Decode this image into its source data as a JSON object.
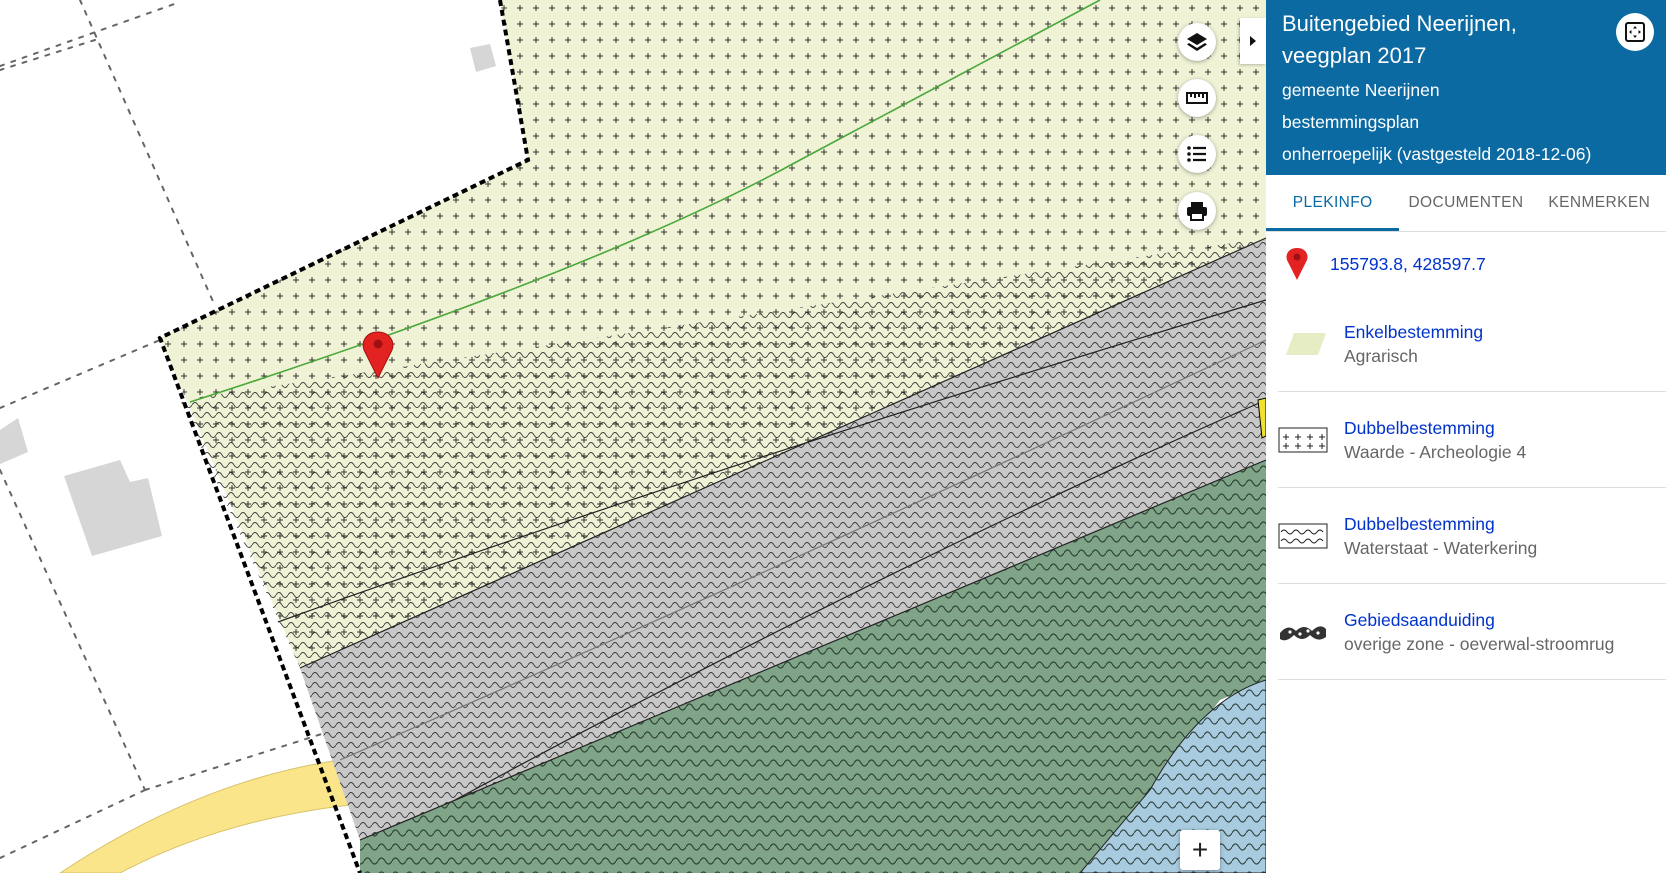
{
  "map": {
    "pin_icon": "map-marker-icon",
    "tools": [
      {
        "name": "layers-button",
        "icon": "layers-icon"
      },
      {
        "name": "measure-button",
        "icon": "ruler-icon"
      },
      {
        "name": "legend-button",
        "icon": "list-icon"
      },
      {
        "name": "print-button",
        "icon": "printer-icon"
      }
    ],
    "zoom_in_label": "+",
    "colors": {
      "agrarisch": "#f0f2d6",
      "waterkering_grey": "#c8c8c8",
      "green_zone": "#7fa488",
      "water": "#a9cbe0",
      "road": "#fbe58a",
      "building": "#d6d6d6"
    }
  },
  "panel": {
    "title": "Buitengebied Neerijnen, veegplan 2017",
    "municipality": "gemeente Neerijnen",
    "plan_type": "bestemmingsplan",
    "status": "onherroepelijk (vastgesteld 2018-12-06)",
    "header_color": "#0b6aa2",
    "tabs": [
      {
        "label": "PLEKINFO"
      },
      {
        "label": "DOCUMENTEN"
      },
      {
        "label": "KENMERKEN"
      }
    ],
    "coordinates": "155793.8, 428597.7",
    "legend": [
      {
        "label": "Enkelbestemming",
        "value": "Agrarisch"
      },
      {
        "label": "Dubbelbestemming",
        "value": "Waarde - Archeologie 4"
      },
      {
        "label": "Dubbelbestemming",
        "value": "Waterstaat - Waterkering"
      },
      {
        "label": "Gebiedsaanduiding",
        "value": "overige zone - oeverwal-stroomrug"
      }
    ]
  }
}
